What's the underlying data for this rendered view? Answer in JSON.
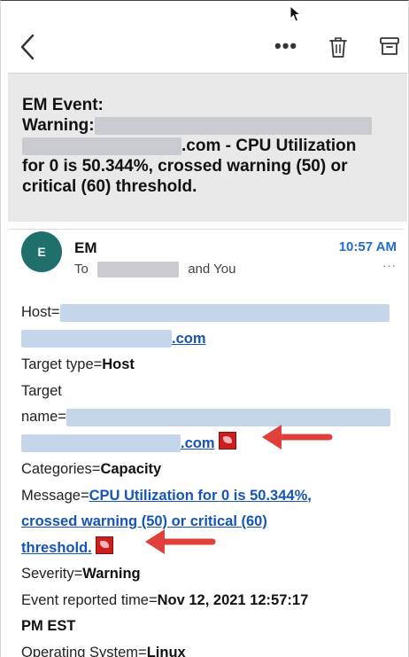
{
  "toolbar": {
    "back_icon": "chevron-left-icon",
    "more_label": "•••",
    "trash_icon": "trash-icon",
    "archive_icon": "archive-icon"
  },
  "subject": {
    "line1": "EM Event:",
    "line2_prefix": "Warning:",
    "line3_suffix": ".com - CPU Utilization",
    "line4": "for 0 is 50.344%, crossed warning (50) or",
    "line5": "critical (60) threshold."
  },
  "sender": {
    "avatar_initial": "E",
    "name": "EM",
    "to_prefix": "To",
    "to_suffix": "and You",
    "time": "10:57 AM",
    "more_label": "···"
  },
  "body": {
    "host_label": "Host=",
    "host_suffix": ".com",
    "target_type_label": "Target type=",
    "target_type_value": "Host",
    "target_label": "Target",
    "name_label": "name=",
    "name_suffix": ".com",
    "categories_label": "Categories=",
    "categories_value": "Capacity",
    "message_label": "Message=",
    "message_line1": "CPU Utilization for 0 is 50.344%,",
    "message_line2": "crossed warning (50) or critical (60)",
    "message_line3": "threshold.",
    "severity_label": "Severity=",
    "severity_value": "Warning",
    "event_time_label": "Event reported time=",
    "event_time_value": "Nov 12, 2021 12:57:17",
    "event_time_value2": "PM EST",
    "os_label": "Operating System=",
    "os_value": "Linux"
  },
  "colors": {
    "accent_blue": "#1e6fd0",
    "link_blue": "#1554b8",
    "avatar_teal": "#1f6f6d",
    "arrow_red": "#e0403a",
    "header_gray": "#e9e9ea"
  }
}
